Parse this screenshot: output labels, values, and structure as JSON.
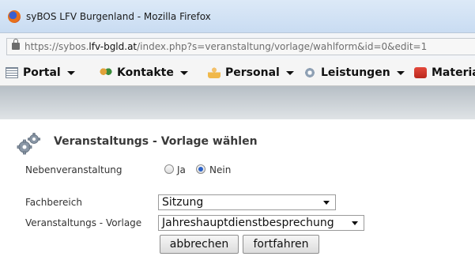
{
  "window": {
    "title": "syBOS LFV Burgenland - Mozilla Firefox"
  },
  "urlbar": {
    "url_prefix": "https://sybos.",
    "url_domain": "lfv-bgld.at",
    "url_path": "/index.php?s=veranstaltung/vorlage/wahlform&id=0&edit=1"
  },
  "menu": {
    "items": [
      {
        "label": "Portal",
        "icon": "portal-icon"
      },
      {
        "label": "Kontakte",
        "icon": "contacts-icon"
      },
      {
        "label": "Personal",
        "icon": "staff-icon"
      },
      {
        "label": "Leistungen",
        "icon": "services-icon"
      },
      {
        "label": "Material",
        "icon": "material-icon"
      }
    ]
  },
  "page": {
    "title": "Veranstaltungs - Vorlage wählen",
    "icon": "gears-icon"
  },
  "form": {
    "nebenveranstaltung": {
      "label": "Nebenveranstaltung",
      "options": [
        "Ja",
        "Nein"
      ],
      "selected": "Nein"
    },
    "fachbereich": {
      "label": "Fachbereich",
      "value": "Sitzung"
    },
    "vorlage": {
      "label": "Veranstaltungs - Vorlage",
      "value": "Jahreshauptdienstbesprechung"
    },
    "buttons": {
      "cancel": "abbrechen",
      "continue": "fortfahren"
    }
  },
  "colors": {
    "radio_checked": "#2d63c8",
    "title_text": "#3a3a3a"
  }
}
